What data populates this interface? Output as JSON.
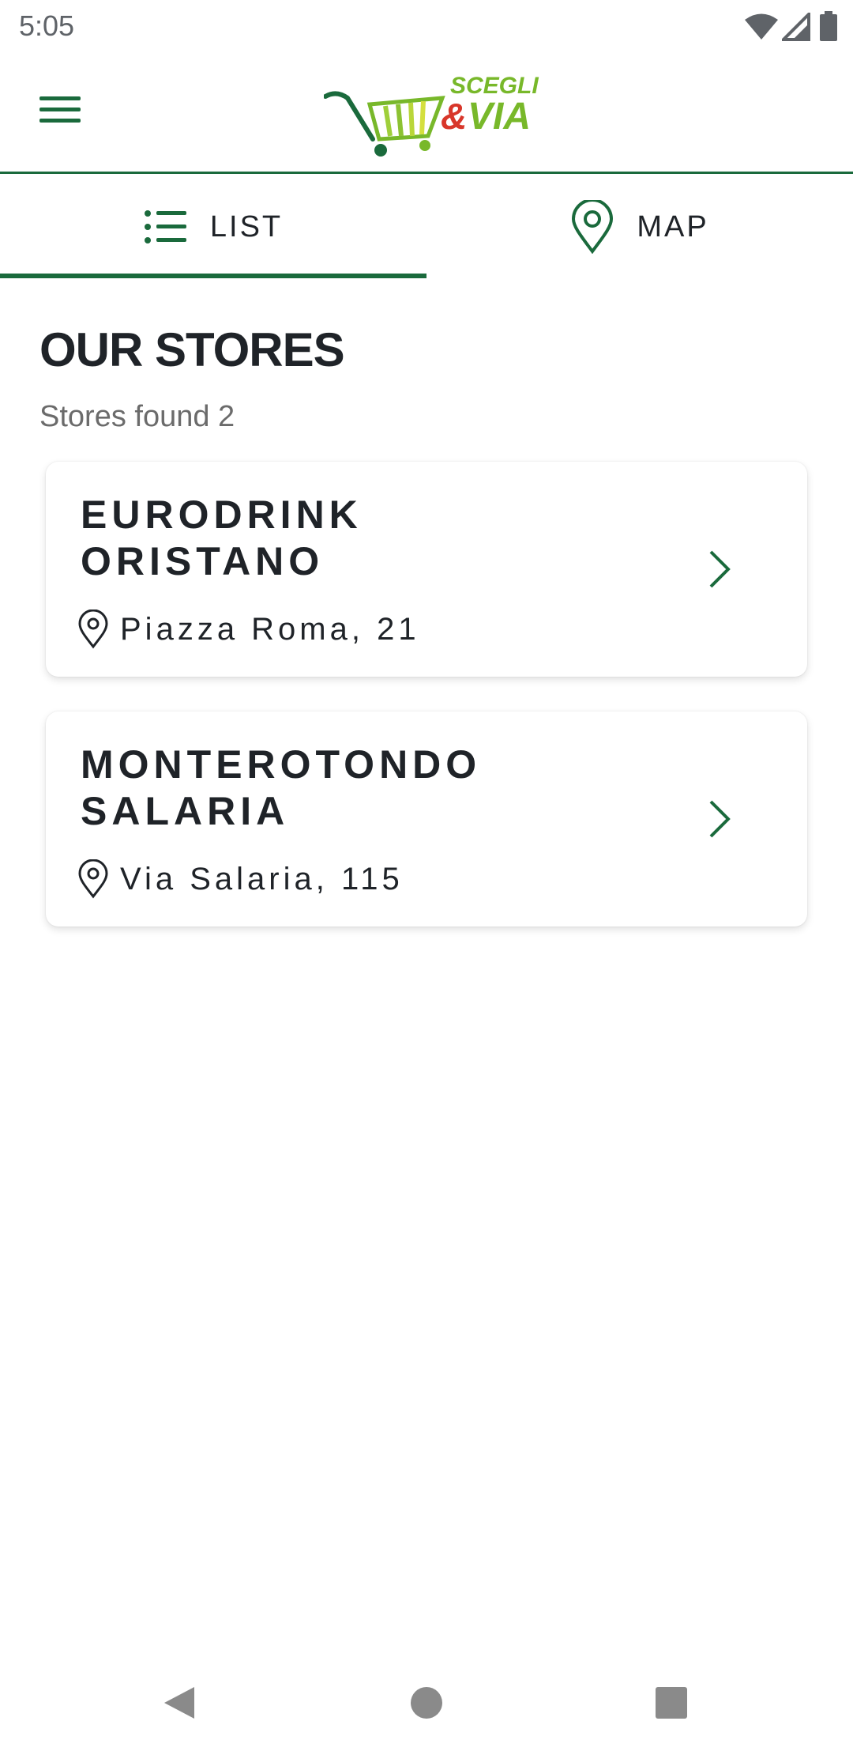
{
  "status_bar": {
    "time": "5:05",
    "icons": [
      "wifi-icon",
      "signal-icon",
      "battery-icon"
    ]
  },
  "app_bar": {
    "menu_icon": "hamburger-menu-icon",
    "logo": {
      "line1": "SCEGLI",
      "amp": "&",
      "line2": "VIA"
    }
  },
  "tabs": [
    {
      "label": "LIST",
      "icon": "list-icon",
      "selected": true
    },
    {
      "label": "MAP",
      "icon": "map-pin-icon",
      "selected": false
    }
  ],
  "main": {
    "title": "OUR STORES",
    "stores_found": "Stores found 2"
  },
  "stores": [
    {
      "name": "EURODRINK\nORISTANO",
      "address": "Piazza Roma, 21"
    },
    {
      "name": "MONTEROTONDO\nSALARIA",
      "address": "Via Salaria, 115"
    }
  ],
  "nav_bar": {
    "icons": [
      "back-icon",
      "home-icon",
      "recents-icon"
    ]
  },
  "colors": {
    "brand_green": "#1a6a3c",
    "logo_lime": "#78b82a",
    "logo_red": "#d8362a"
  }
}
